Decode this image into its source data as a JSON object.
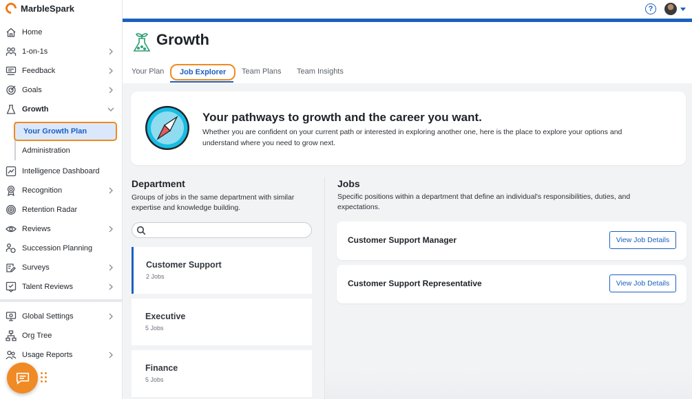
{
  "brand": {
    "name": "MarbleSpark"
  },
  "sidebar": {
    "items": [
      {
        "label": "Home",
        "icon": "home-icon",
        "chevron": false
      },
      {
        "label": "1-on-1s",
        "icon": "people-icon",
        "chevron": true
      },
      {
        "label": "Feedback",
        "icon": "feedback-icon",
        "chevron": true
      },
      {
        "label": "Goals",
        "icon": "target-icon",
        "chevron": true
      },
      {
        "label": "Growth",
        "icon": "growth-icon",
        "chevron": true
      },
      {
        "label": "Intelligence Dashboard",
        "icon": "dashboard-icon",
        "chevron": false
      },
      {
        "label": "Recognition",
        "icon": "award-icon",
        "chevron": true
      },
      {
        "label": "Retention Radar",
        "icon": "radar-icon",
        "chevron": false
      },
      {
        "label": "Reviews",
        "icon": "eye-icon",
        "chevron": true
      },
      {
        "label": "Succession Planning",
        "icon": "succession-icon",
        "chevron": false
      },
      {
        "label": "Surveys",
        "icon": "survey-icon",
        "chevron": true
      },
      {
        "label": "Talent Reviews",
        "icon": "talent-icon",
        "chevron": true
      },
      {
        "label": "Global Settings",
        "icon": "settings-icon",
        "chevron": true
      },
      {
        "label": "Org Tree",
        "icon": "org-tree-icon",
        "chevron": false
      },
      {
        "label": "Usage Reports",
        "icon": "usage-icon",
        "chevron": true
      }
    ],
    "growth_sub": [
      {
        "label": "Your Growth Plan"
      },
      {
        "label": "Administration"
      }
    ]
  },
  "header": {
    "title": "Growth",
    "tabs": [
      "Your Plan",
      "Job Explorer",
      "Team Plans",
      "Team Insights"
    ],
    "active_tab": "Job Explorer",
    "help_glyph": "?"
  },
  "hero": {
    "title": "Your pathways to growth and the career you want.",
    "text": "Whether you are confident on your current path or interested in exploring another one, here is the place to explore your options and understand where you need to grow next."
  },
  "department": {
    "title": "Department",
    "description": "Groups of jobs in the same department with similar expertise and knowledge building.",
    "search_value": "",
    "items": [
      {
        "name": "Customer Support",
        "count": "2 Jobs"
      },
      {
        "name": "Executive",
        "count": "5 Jobs"
      },
      {
        "name": "Finance",
        "count": "5 Jobs"
      }
    ]
  },
  "jobs": {
    "title": "Jobs",
    "description": "Specific positions within a department that define an individual's responsibilities, duties, and expectations.",
    "items": [
      {
        "title": "Customer Support Manager",
        "button": "View Job Details"
      },
      {
        "title": "Customer Support Representative",
        "button": "View Job Details"
      }
    ]
  },
  "colors": {
    "accent": "#1b5fc1",
    "highlight": "#f0891c",
    "brand_orange": "#f08a24",
    "growth_green": "#2a9d6e"
  }
}
